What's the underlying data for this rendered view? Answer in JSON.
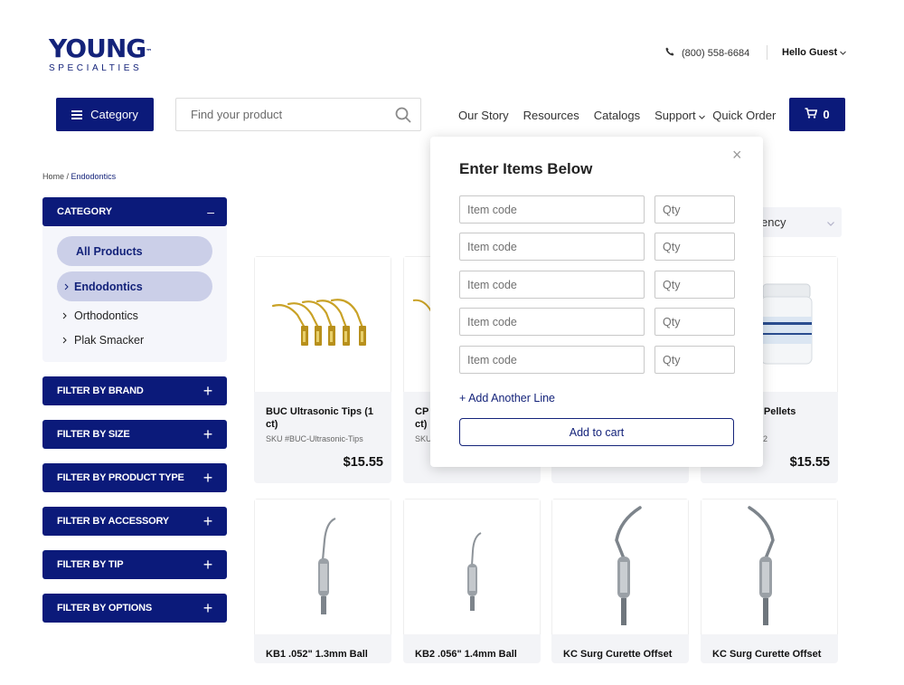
{
  "header": {
    "logo_main": "YOUNG",
    "logo_tm": "™",
    "logo_sub": "SPECIALTIES",
    "phone": "(800) 558-6684",
    "guest": "Hello Guest",
    "category_button": "Category",
    "search_placeholder": "Find your product",
    "nav": [
      "Our Story",
      "Resources",
      "Catalogs",
      "Support",
      "Quick Order"
    ],
    "cart_count": "0"
  },
  "breadcrumb": {
    "home": "Home",
    "sep": " / ",
    "current": "Endodontics"
  },
  "sidebar": {
    "category_title": "CATEGORY",
    "category_toggle": "–",
    "all_products": "All Products",
    "active": "Endodontics",
    "items": [
      "Orthodontics",
      "Plak Smacker"
    ],
    "filters": [
      "FILTER BY BRAND",
      "FILTER BY SIZE",
      "FILTER BY PRODUCT TYPE",
      "FILTER BY ACCESSORY",
      "FILTER BY TIP",
      "FILTER BY OPTIONS"
    ],
    "filter_toggle": "+"
  },
  "sort": {
    "visible_text": "ency"
  },
  "products": [
    {
      "name": "BUC Ultrasonic Tips (1 ct)",
      "sku": "SKU #BUC-Ultrasonic-Tips",
      "price": "$15.55"
    },
    {
      "name": "CP",
      "name2": "ct)",
      "sku": "SKU"
    },
    {
      "name": "",
      "sku": ""
    },
    {
      "name": "ha Pellets",
      "sku": "02",
      "price": "$15.55"
    },
    {
      "name": "KB1 .052\" 1.3mm Ball"
    },
    {
      "name": "KB2 .056\" 1.4mm Ball"
    },
    {
      "name": "KC Surg Curette Offset"
    },
    {
      "name": "KC Surg Curette Offset"
    }
  ],
  "modal": {
    "title": "Enter Items Below",
    "close": "×",
    "item_placeholder": "Item code",
    "qty_placeholder": "Qty",
    "add_line": "+ Add Another Line",
    "add_to_cart": "Add to cart"
  },
  "colors": {
    "navy": "#0b1a7a",
    "pill": "#cbcfe8",
    "accent_gold": "#c9a227"
  }
}
